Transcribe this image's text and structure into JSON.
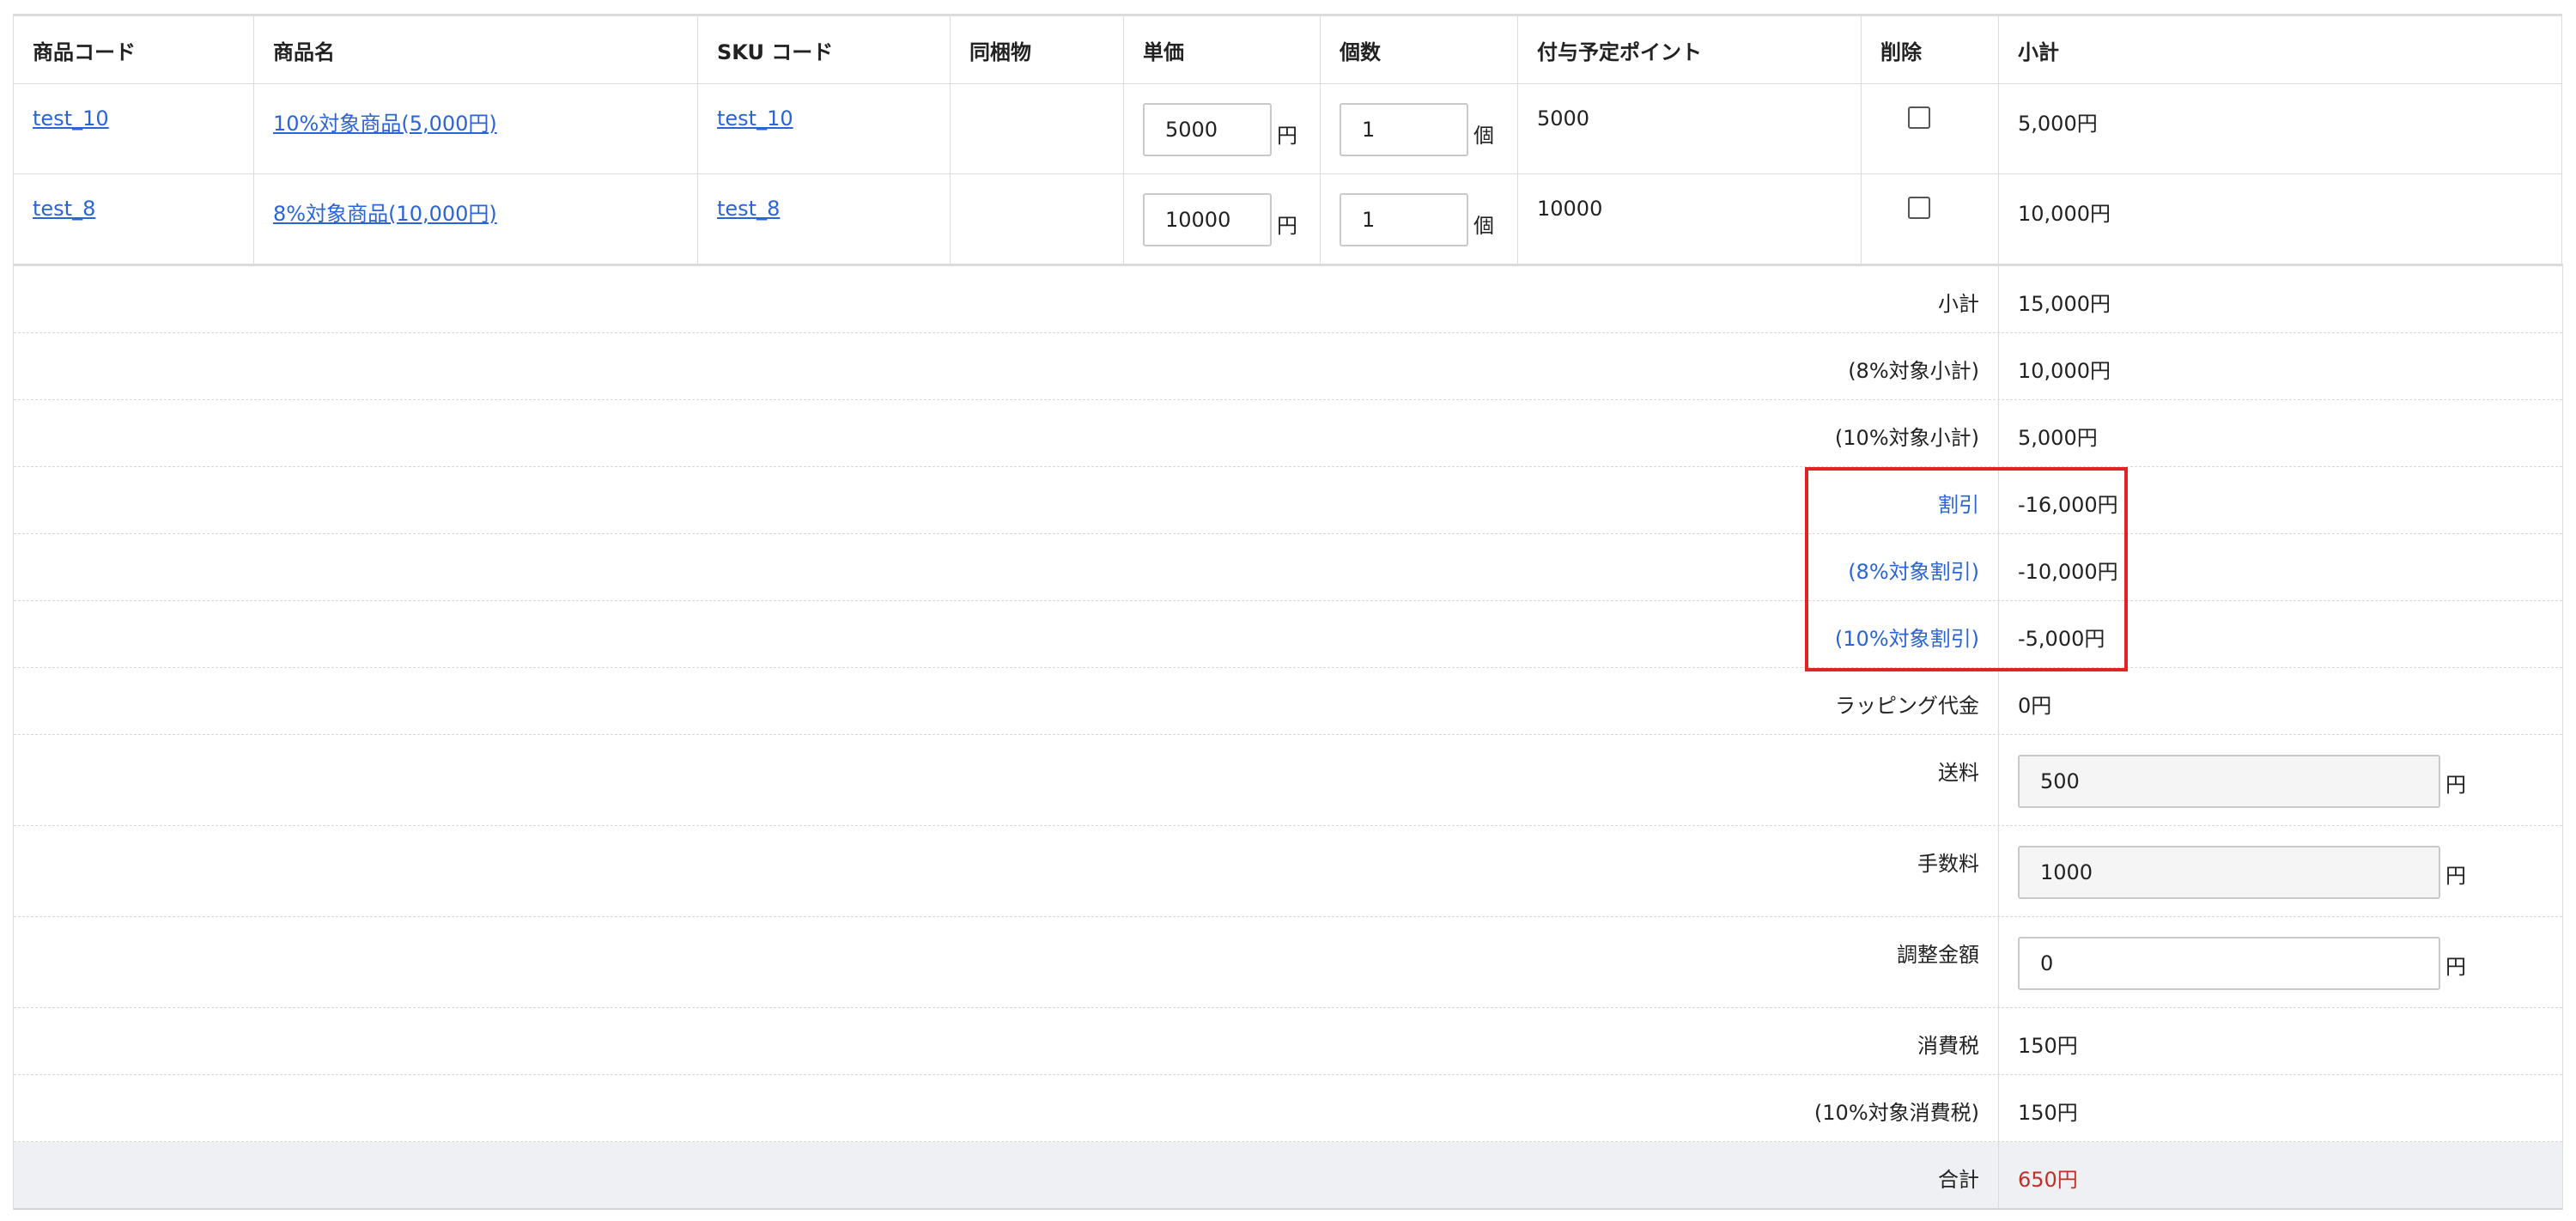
{
  "headers": {
    "product_code": "商品コード",
    "product_name": "商品名",
    "sku_code": "SKU コード",
    "bundled": "同梱物",
    "unit_price": "単価",
    "quantity": "個数",
    "points": "付与予定ポイント",
    "delete": "削除",
    "subtotal": "小計"
  },
  "rows": [
    {
      "product_code": "test_10",
      "product_name": "10%対象商品(5,000円)",
      "sku_code": "test_10",
      "bundled": "",
      "unit_price": "5000",
      "unit_price_unit": "円",
      "quantity": "1",
      "quantity_unit": "個",
      "points": "5000",
      "subtotal": "5,000円"
    },
    {
      "product_code": "test_8",
      "product_name": "8%対象商品(10,000円)",
      "sku_code": "test_8",
      "bundled": "",
      "unit_price": "10000",
      "unit_price_unit": "円",
      "quantity": "1",
      "quantity_unit": "個",
      "points": "10000",
      "subtotal": "10,000円"
    }
  ],
  "summary": {
    "subtotal": {
      "label": "小計",
      "value": "15,000円"
    },
    "subtotal_8": {
      "label": "(8%対象小計)",
      "value": "10,000円"
    },
    "subtotal_10": {
      "label": "(10%対象小計)",
      "value": "5,000円"
    },
    "discount": {
      "label": "割引",
      "value": "-16,000円"
    },
    "discount_8": {
      "label": "(8%対象割引)",
      "value": "-10,000円"
    },
    "discount_10": {
      "label": "(10%対象割引)",
      "value": "-5,000円"
    },
    "wrapping": {
      "label": "ラッピング代金",
      "value": "0円"
    },
    "shipping": {
      "label": "送料",
      "value": "500",
      "unit": "円"
    },
    "fee": {
      "label": "手数料",
      "value": "1000",
      "unit": "円"
    },
    "adjustment": {
      "label": "調整金額",
      "value": "0",
      "unit": "円"
    },
    "tax": {
      "label": "消費税",
      "value": "150円"
    },
    "tax_10": {
      "label": "(10%対象消費税)",
      "value": "150円"
    },
    "total": {
      "label": "合計",
      "value": "650円"
    }
  },
  "colors": {
    "link": "#2a64d6",
    "highlight_box": "#e02424",
    "total_value": "#c0302a",
    "total_row_bg": "#eef0f4"
  }
}
